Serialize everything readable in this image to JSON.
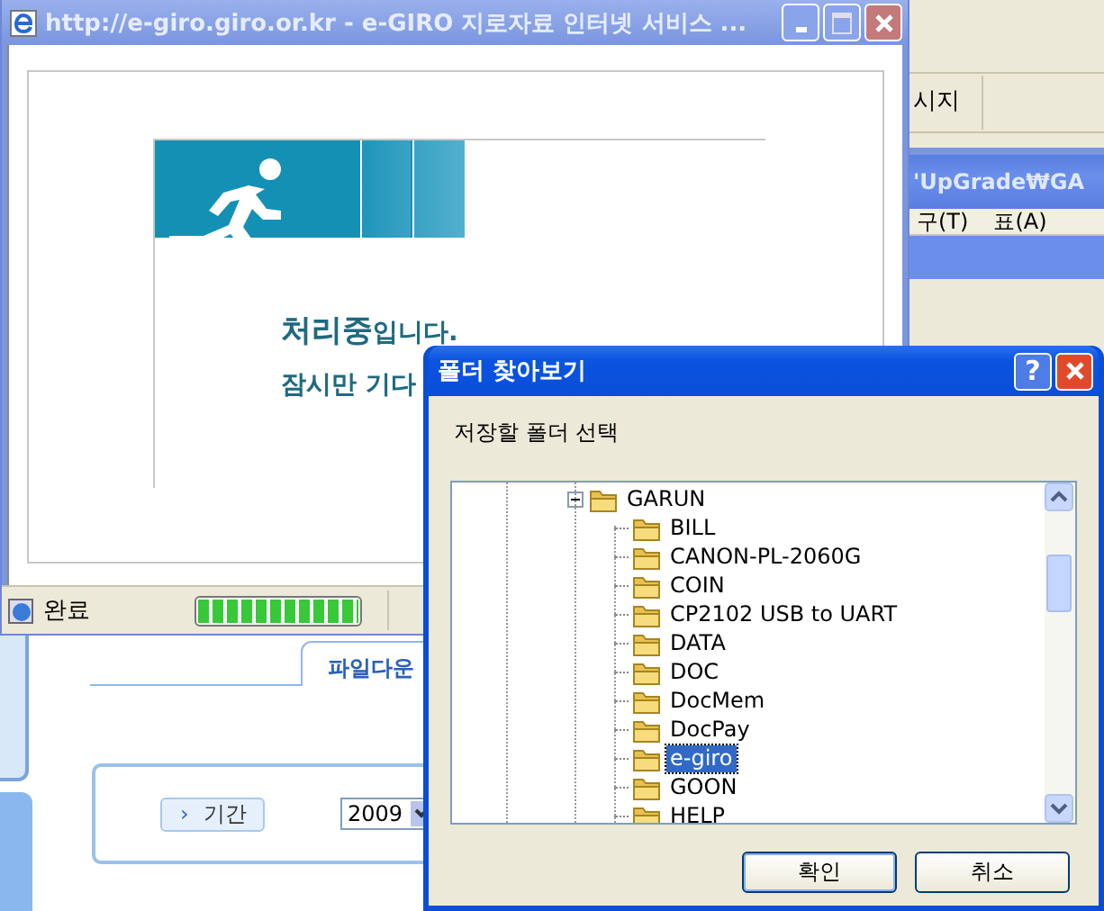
{
  "background_window": {
    "tab_label": "시지",
    "title": "'UpGrade₩GA",
    "menu": [
      "구(T)",
      "표(A)"
    ]
  },
  "popup": {
    "title": "http://e-giro.giro.or.kr - e-GIRO 지로자료 인터넷 서비스 ...",
    "message": "**처리중**입니다.",
    "submessage": "잠시만 기다",
    "status": "완료",
    "progress": {
      "level": 1
    }
  },
  "web_page": {
    "tab": {
      "label": "파일다운",
      "selected": true
    },
    "period_button": {
      "arrow": "›",
      "label": "기간"
    },
    "year": "2009"
  },
  "dialog": {
    "title": "폴더 찾아보기",
    "help": "?",
    "prompt": "저장할 폴더 선택",
    "tree": [
      {
        "name": "GARUN",
        "expanded": true,
        "selected": false,
        "children": [
          {
            "name": "BILL",
            "selected": false
          },
          {
            "name": "CANON-PL-2060G",
            "selected": false
          },
          {
            "name": "COIN",
            "selected": false
          },
          {
            "name": "CP2102 USB to UART",
            "selected": false
          },
          {
            "name": "DATA",
            "selected": false
          },
          {
            "name": "DOC",
            "selected": false
          },
          {
            "name": "DocMem",
            "selected": false
          },
          {
            "name": "DocPay",
            "selected": false
          },
          {
            "name": "e-giro",
            "selected": true
          },
          {
            "name": "GOON",
            "selected": false
          },
          {
            "name": "HELP",
            "selected": false
          }
        ]
      }
    ],
    "buttons": [
      "확인",
      "취소"
    ]
  }
}
